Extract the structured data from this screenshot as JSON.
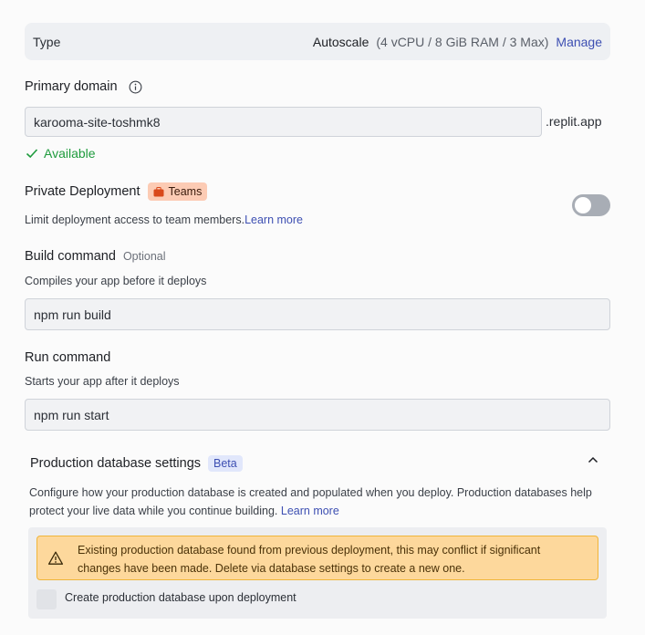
{
  "type_row": {
    "label": "Type",
    "value": "Autoscale",
    "details": "(4 vCPU / 8 GiB RAM / 3 Max)",
    "manage": "Manage"
  },
  "domain": {
    "label": "Primary domain",
    "value": "karooma-site-toshmk8",
    "suffix": ".replit.app",
    "status": "Available"
  },
  "private": {
    "label": "Private Deployment",
    "badge": "Teams",
    "description": "Limit deployment access to team members.",
    "learn_more": "Learn more",
    "enabled": false
  },
  "build": {
    "label": "Build command",
    "optional": "Optional",
    "description": "Compiles your app before it deploys",
    "value": "npm run build"
  },
  "run": {
    "label": "Run command",
    "description": "Starts your app after it deploys",
    "value": "npm run start"
  },
  "prod_db": {
    "title": "Production database settings",
    "badge": "Beta",
    "description": "Configure how your production database is created and populated when you deploy. Production databases help protect your live data while you continue building.",
    "learn_more": "Learn more",
    "warning_line1": "Existing production database found from previous deployment, this may conflict if significant",
    "warning_line2": "changes have been made. Delete via database settings to create a new one.",
    "checkbox_label": "Create production database upon deployment",
    "checked": false
  },
  "colors": {
    "accent_link": "#3d4fb2",
    "success": "#1e9b3d",
    "teams_badge_bg": "#fccbb4",
    "warning_bg": "#fdd89c",
    "warning_border": "#f0b53a"
  }
}
